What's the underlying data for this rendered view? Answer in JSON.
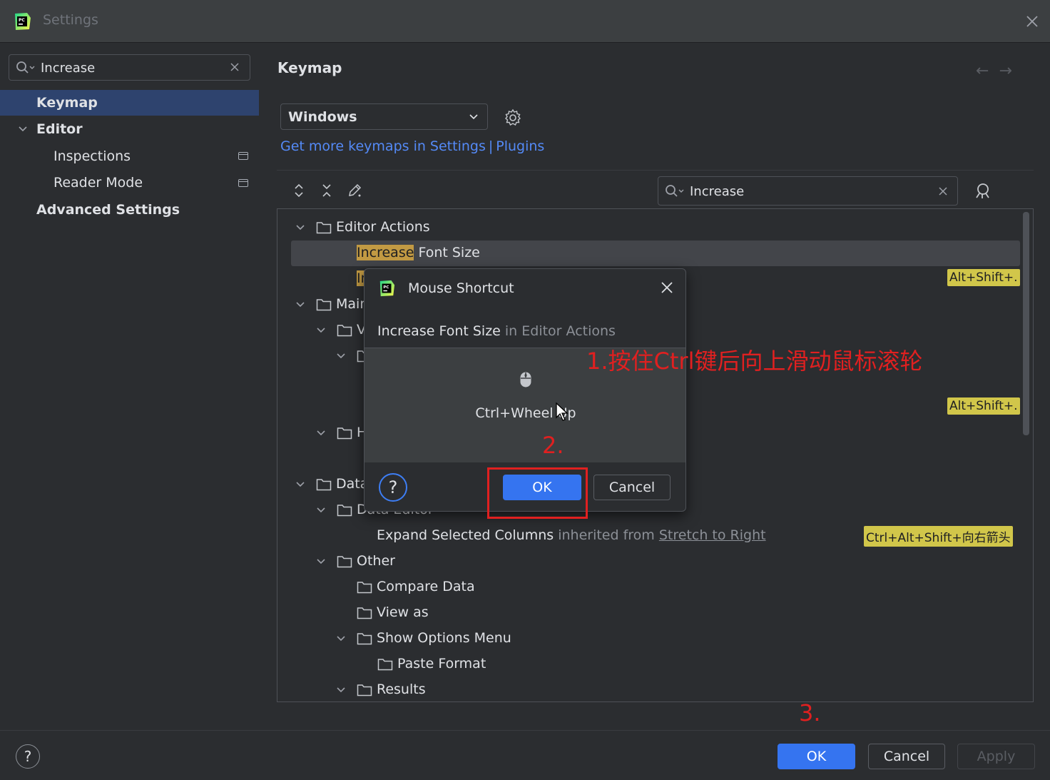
{
  "window": {
    "title": "Settings"
  },
  "left": {
    "search_value": "Increase",
    "nav": [
      {
        "label": "Keymap"
      },
      {
        "label": "Editor"
      },
      {
        "label": "Inspections"
      },
      {
        "label": "Reader Mode"
      },
      {
        "label": "Advanced Settings"
      }
    ]
  },
  "keymap": {
    "title": "Keymap",
    "selected_keymap": "Windows",
    "link_text": "Get more keymaps in Settings",
    "link_sep": "|",
    "link_plugins": "Plugins",
    "search_value": "Increase"
  },
  "tree": {
    "editor_actions": "Editor Actions",
    "increase_hl": "Increase",
    "increase_rest": " Font Size",
    "row2_hl": "In",
    "main": "Main",
    "v": "V",
    "h": "H",
    "data": "Data",
    "data_editor": "Data Editor",
    "expand_label": "Expand Selected Columns",
    "inherited": " inherited from ",
    "stretch": "Stretch to Right",
    "other": "Other",
    "compare": "Compare Data",
    "view_as": "View as",
    "show_options": "Show Options Menu",
    "paste_format": "Paste Format",
    "results": "Results",
    "badge1": "Alt+Shift+.",
    "badge2": "Alt+Shift+.",
    "badge3": "Ctrl+Alt+Shift+向右箭头"
  },
  "dialog": {
    "title": "Mouse Shortcut",
    "action_name": "Increase Font Size",
    "action_group": " in Editor Actions",
    "shortcut": "Ctrl+Wheel Up",
    "help": "?",
    "ok": "OK",
    "cancel": "Cancel"
  },
  "annotations": {
    "step1": "1.按住Ctrl键后向上滑动鼠标滚轮",
    "step2": "2.",
    "step3": "3."
  },
  "footer": {
    "help": "?",
    "ok": "OK",
    "cancel": "Cancel",
    "apply": "Apply"
  },
  "colors": {
    "accent": "#3574f0",
    "highlight": "#c29a43",
    "badge": "#d1c64a",
    "annotation": "#e02020"
  }
}
